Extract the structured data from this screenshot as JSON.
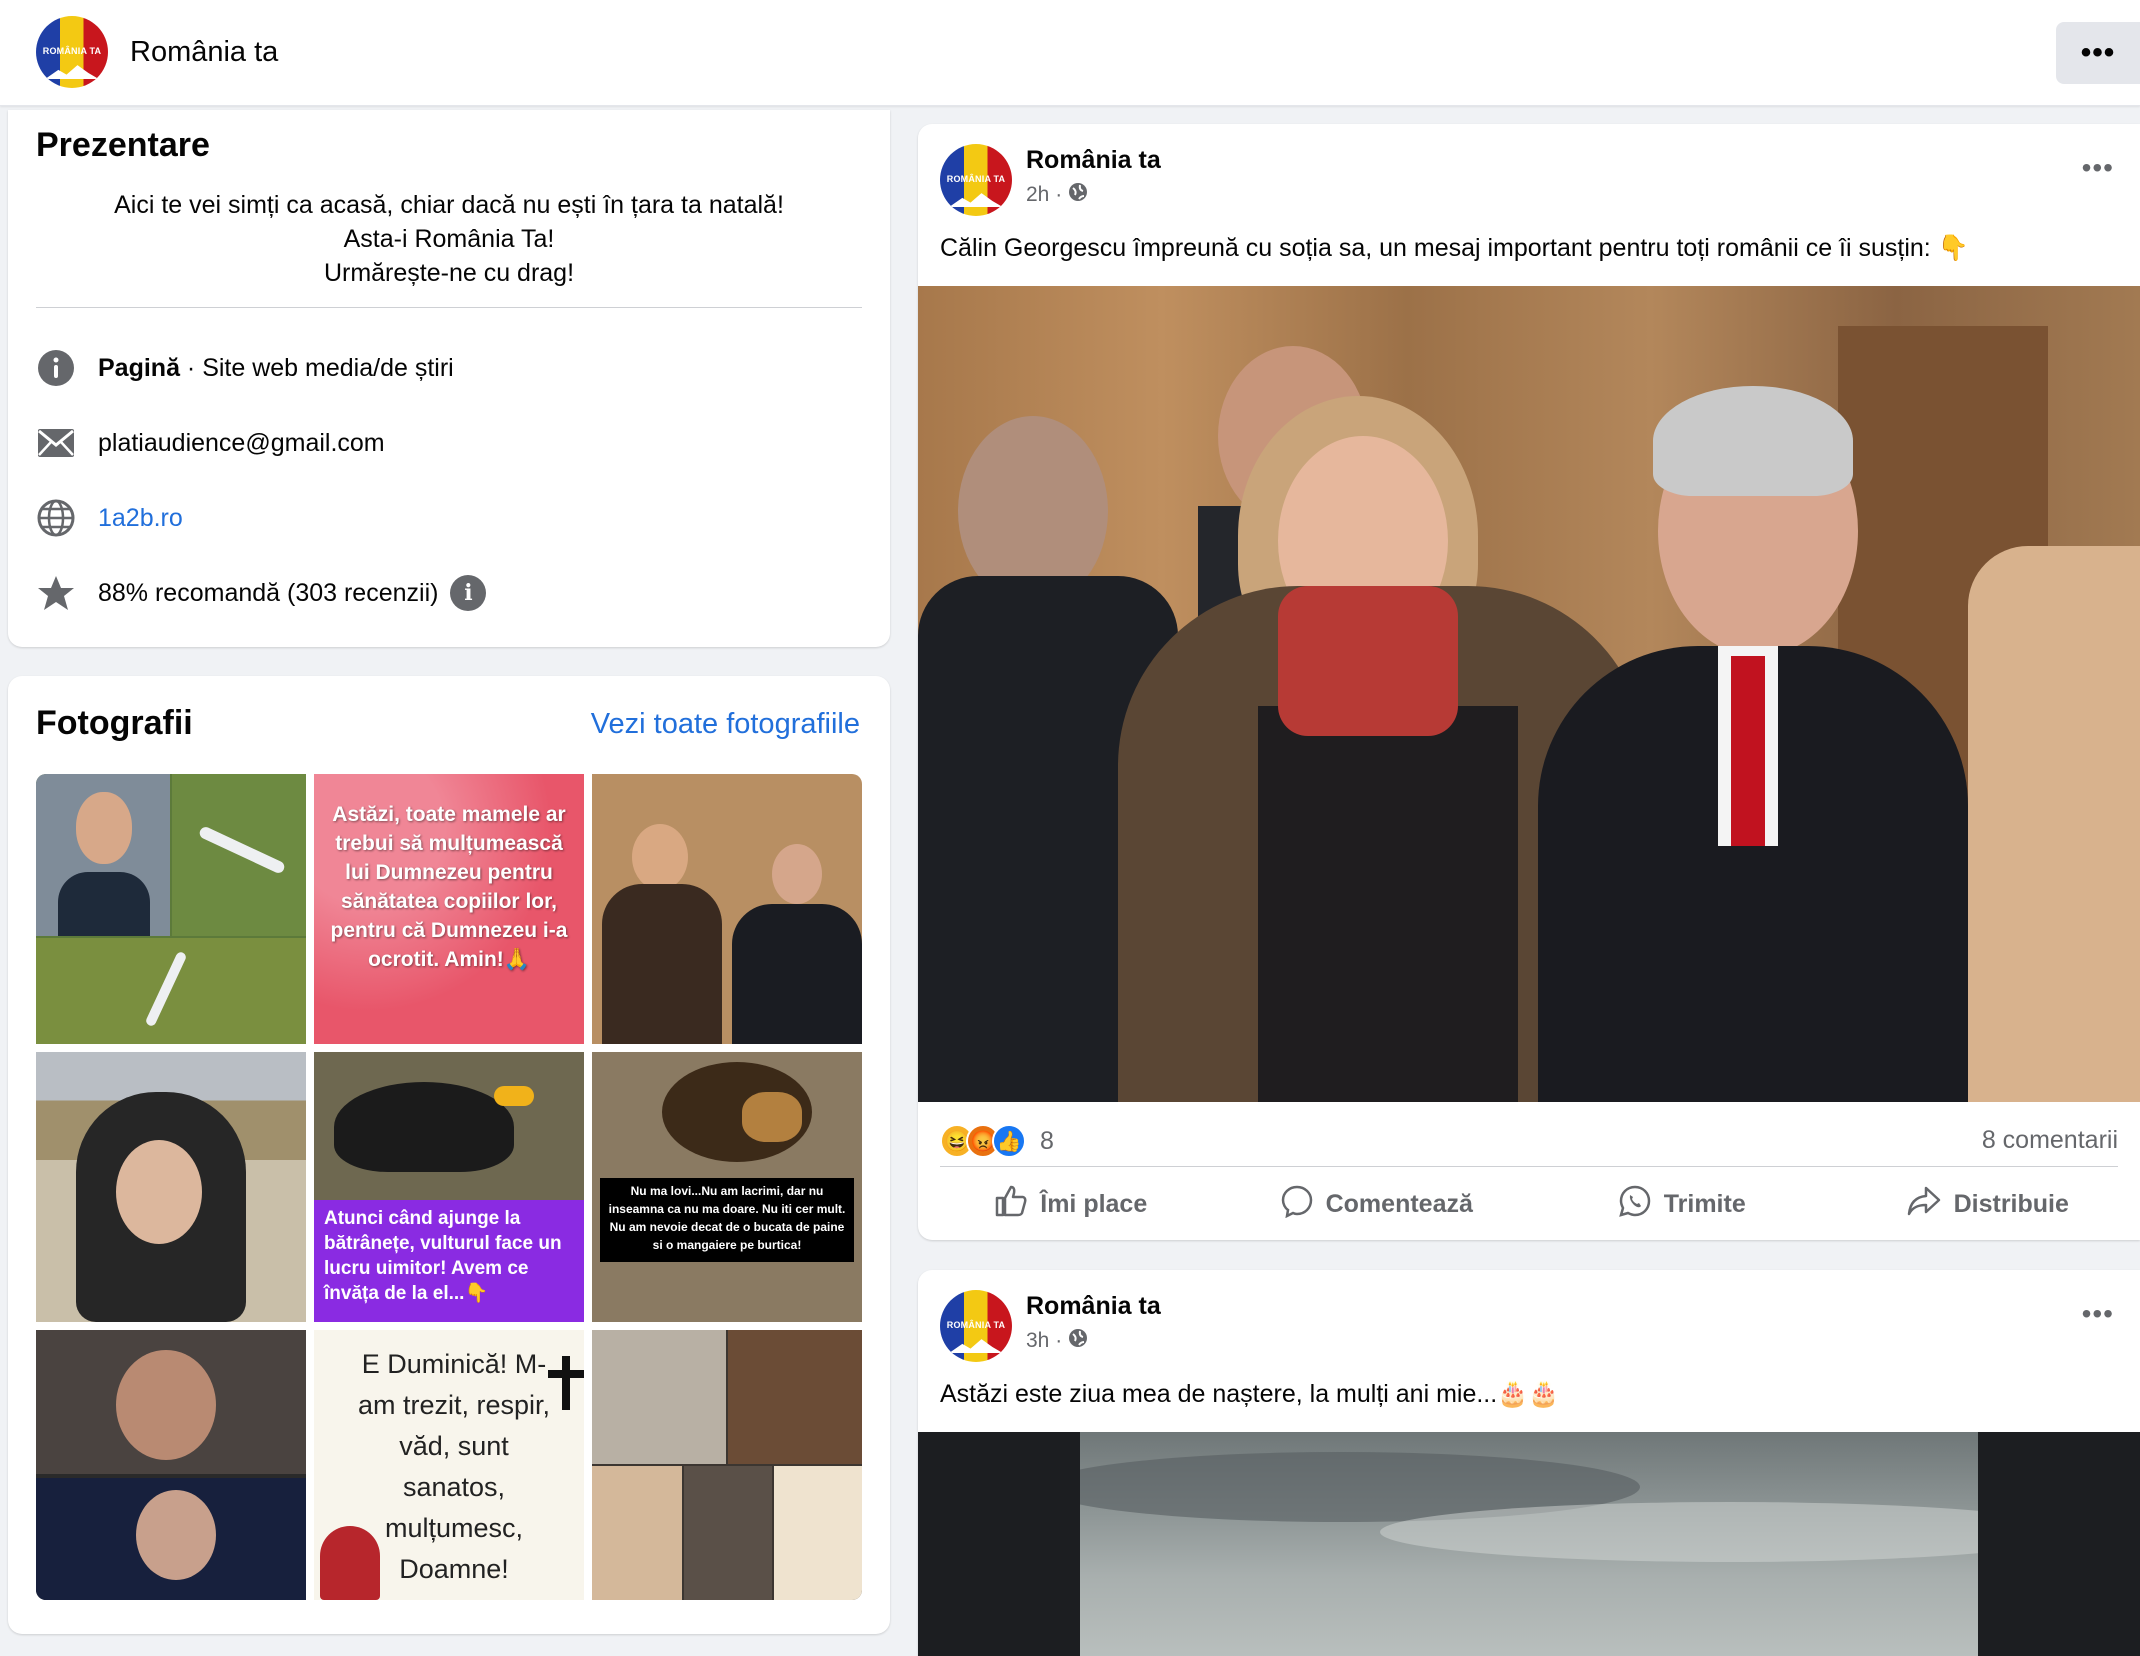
{
  "header": {
    "page_name": "România ta",
    "more_label": "•••",
    "logo_text": "ROMÂNIA TA"
  },
  "intro": {
    "title": "Prezentare",
    "bio_lines": [
      "Aici te vei simți ca acasă, chiar dacă nu ești în țara ta natală!",
      "Asta-i România Ta!",
      "Urmărește-ne cu drag!"
    ],
    "category_label": "Pagină",
    "category_value": " · Site web media/de știri",
    "email": "platiaudience@gmail.com",
    "website": "1a2b.ro",
    "rating": "88% recomandă (303 recenzii)",
    "info_glyph": "i"
  },
  "photos": {
    "title": "Fotografii",
    "see_all": "Vezi toate fotografiile",
    "captions": {
      "mothers": "Astăzi, toate mamele ar trebui să mulțumească lui Dumnezeu pentru sănătatea copiilor lor, pentru că Dumnezeu i-a ocrotit. Amin!🙏",
      "eagle": "Atunci când ajunge la bătrânețe, vulturul face un lucru uimitor! Avem ce învăța de la el...👇",
      "dog": "Nu ma lovi...Nu am lacrimi, dar nu inseamna ca nu ma doare. Nu iti cer mult. Nu am nevoie decat de o bucata de paine si o mangaiere pe burtica!",
      "sunday": "E Duminică! M-am trezit, respir, văd, sunt sanatos, mulțumesc, Doamne!"
    }
  },
  "posts": [
    {
      "author": "România ta",
      "time": "2h ·",
      "text": "Călin Georgescu împreună cu soția sa, un mesaj important pentru toți românii ce îi susțin:  👇",
      "reaction_count": "8",
      "comments": "8 comentarii",
      "actions": [
        "Îmi place",
        "Comentează",
        "Trimite",
        "Distribuie"
      ]
    },
    {
      "author": "România ta",
      "time": "3h ·",
      "text": "Astăzi este ziua mea de naștere, la mulți ani mie...🎂🎂"
    }
  ],
  "colors": {
    "link": "#216fdb",
    "background": "#f0f2f5",
    "secondary_text": "#65676b",
    "eagle_caption_bg": "#8a2be2",
    "mothers_bg": "#e8566a"
  },
  "icons": [
    "info-icon",
    "envelope-icon",
    "globe-icon",
    "star-icon",
    "globe-audience-icon",
    "like-icon",
    "comment-icon",
    "whatsapp-icon",
    "share-icon"
  ]
}
